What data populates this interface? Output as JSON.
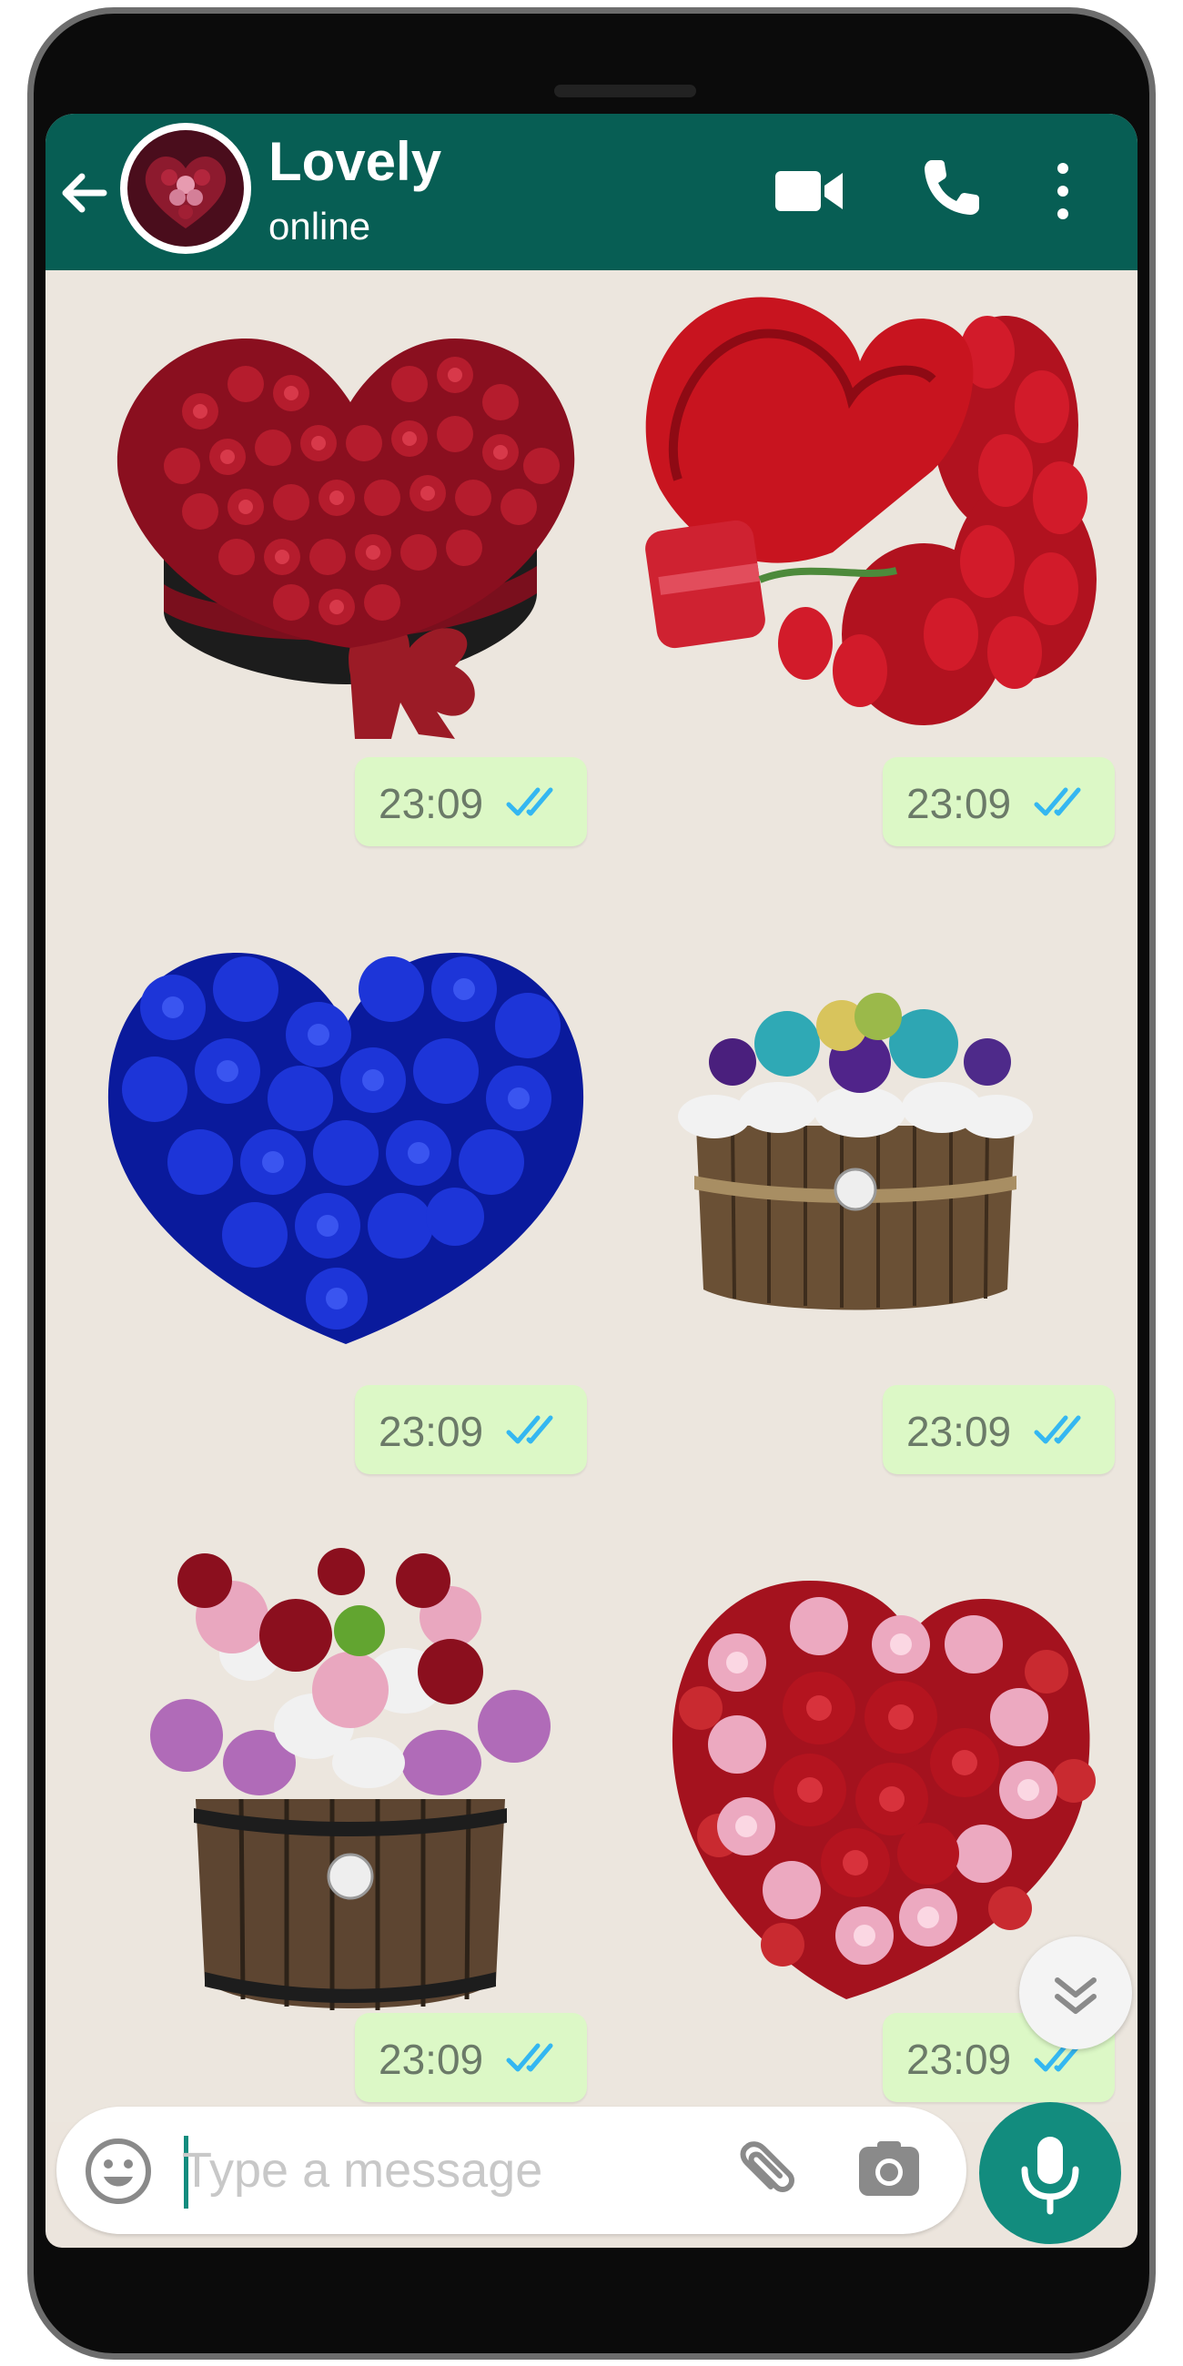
{
  "chat": {
    "contact_name": "Lovely",
    "status": "online"
  },
  "header_icons": [
    "arrow-left-icon",
    "video-camera-icon",
    "phone-icon",
    "more-vertical-icon"
  ],
  "messages": [
    {
      "sticker": "red-rose-heart-box",
      "time": "23:09",
      "ticks": "double-check-read"
    },
    {
      "sticker": "red-velvet-heart-with-roses",
      "time": "23:09",
      "ticks": "double-check-read"
    },
    {
      "sticker": "blue-rose-heart",
      "time": "23:09",
      "ticks": "double-check-read"
    },
    {
      "sticker": "mixed-flowers-wooden-basket",
      "time": "23:09",
      "ticks": "double-check-read"
    },
    {
      "sticker": "flower-bucket-arrangement",
      "time": "23:09",
      "ticks": "double-check-read"
    },
    {
      "sticker": "red-pink-rose-heart",
      "time": "23:09",
      "ticks": "double-check-read"
    }
  ],
  "composer": {
    "placeholder": "Type a message",
    "icons": [
      "emoji-icon",
      "attach-icon",
      "camera-icon",
      "microphone-icon"
    ]
  },
  "colors": {
    "header": "#075e54",
    "bubble": "#dcf8c6",
    "read_ticks": "#34b7f1",
    "mic_button": "#128c7e",
    "chat_bg": "#ece6de"
  }
}
